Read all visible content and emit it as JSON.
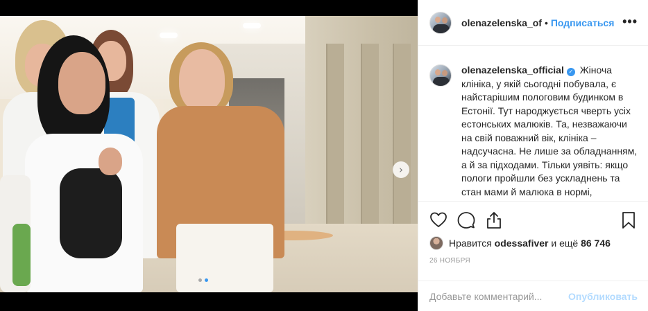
{
  "post": {
    "carousel": {
      "total_slides": 2,
      "active_slide": 2
    },
    "colors": {
      "accent": "#3897f0",
      "publish_disabled": "#b3dbff",
      "muted_text": "#999999"
    },
    "icons": {
      "next": "chevron-right-icon",
      "more": "more-options-icon",
      "verified": "verified-badge-icon",
      "like": "heart-icon",
      "comment": "comment-icon",
      "share": "share-icon",
      "save": "bookmark-icon"
    }
  },
  "header": {
    "username": "olenazelenska_of",
    "separator": "•",
    "follow_label": "Подписаться",
    "more_label": "•••"
  },
  "caption": {
    "username": "olenazelenska_official",
    "verified_mark": "✓",
    "text": "Жіноча клініка, у якій сьогодні побувала, є найстарішим пологовим будинком в Естонії. Тут народжується чверть усіх естонських малюків. Та, незважаючи на свій поважний вік, клініка – надсучасна. Не лише за обладнанням, а й за підходами. Тільки уявіть: якщо пологи пройшли без ускладнень та стан мами й малюка в нормі, породілей"
  },
  "likes": {
    "prefix": "Нравится",
    "user": "odessafiver",
    "middle": "и ещё",
    "count": "86 746"
  },
  "date": "26 ноября",
  "comment": {
    "placeholder": "Добавьте комментарий...",
    "publish_label": "Опубликовать"
  }
}
